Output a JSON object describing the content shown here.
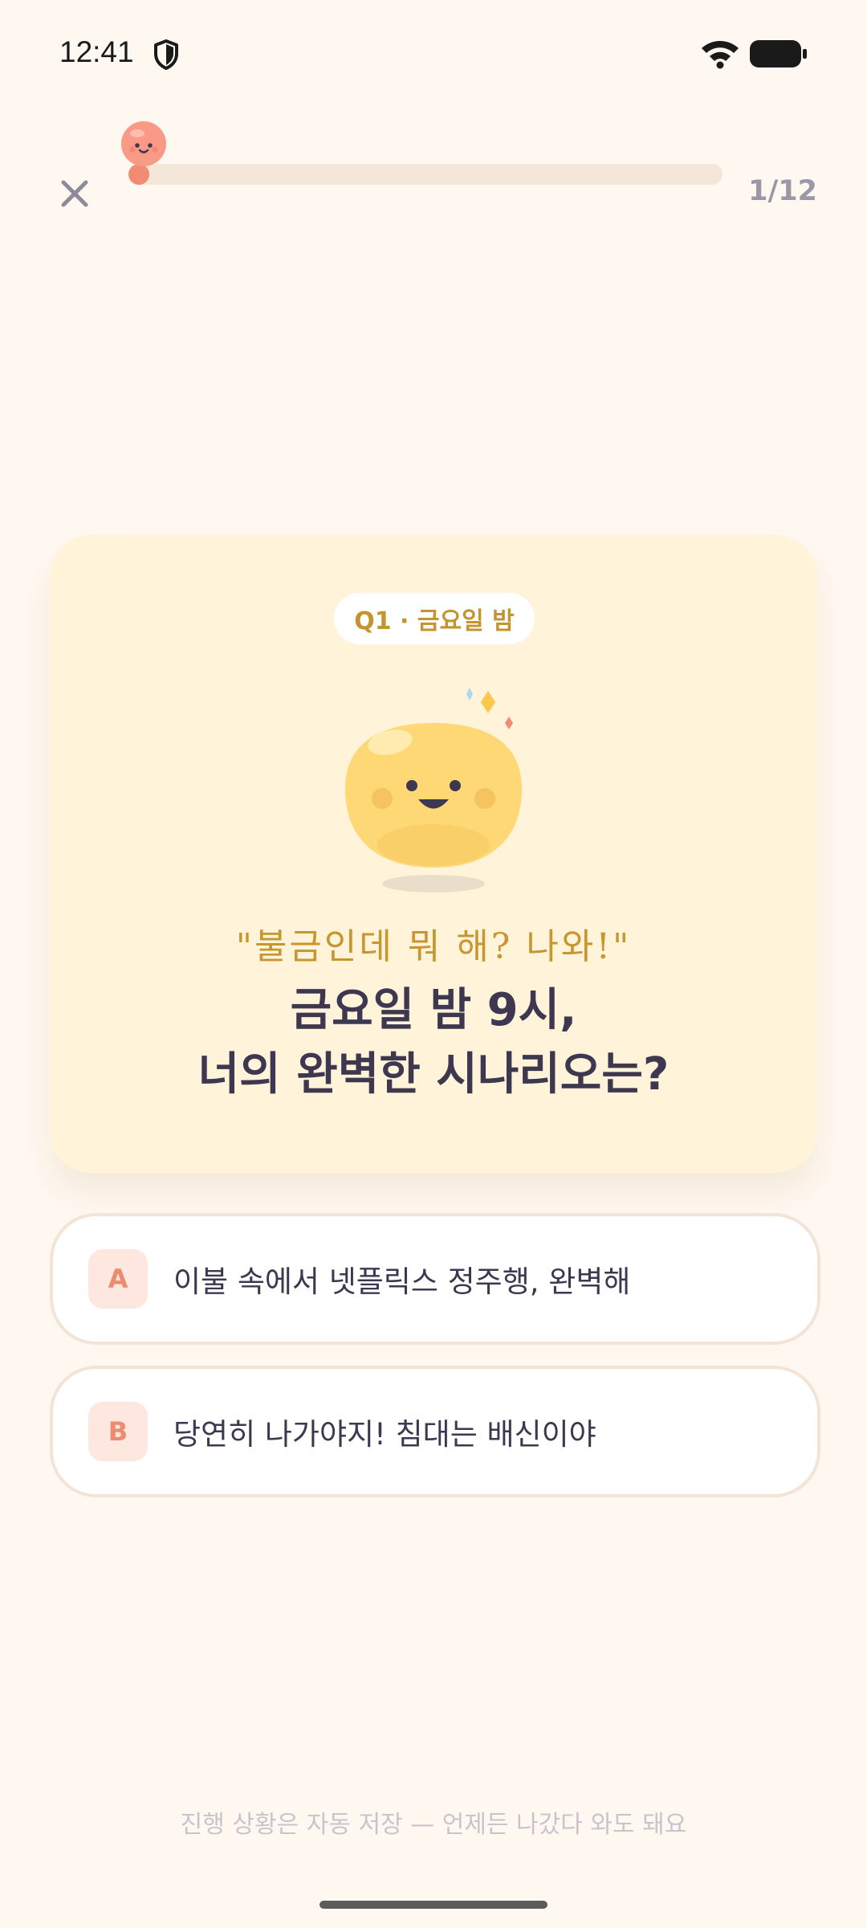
{
  "status_bar": {
    "time": "12:41",
    "shield_icon": "shield-icon",
    "wifi_icon": "wifi-icon",
    "battery_icon": "battery-icon"
  },
  "top_bar": {
    "close_icon": "close-icon",
    "progress": {
      "current": 1,
      "total": 12,
      "fraction": 0.0833,
      "label": "1/12"
    },
    "progress_mascot_icon": "mascot-face-icon"
  },
  "question_card": {
    "chip_label": "Q1 · 금요일 밤",
    "mascot_icon": "smiling-blob-mascot-icon",
    "speech": "\"불금인데 뭐 해? 나와!\"",
    "question_line1": "금요일 밤 9시,",
    "question_line2": "너의 완벽한 시나리오는?"
  },
  "options": [
    {
      "badge": "A",
      "text": "이불 속에서 넷플릭스 정주행, 완벽해"
    },
    {
      "badge": "B",
      "text": "당연히 나가야지! 침대는 배신이야"
    }
  ],
  "footer": {
    "note": "진행 상황은 자동 저장 — 언제든 나갔다 와도 돼요"
  },
  "colors": {
    "background": "#FFF8F1",
    "card": "#FFF4DA",
    "accent": "#F28B74",
    "title": "#3D3850",
    "gold": "#C8962E"
  }
}
